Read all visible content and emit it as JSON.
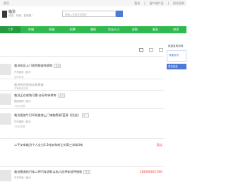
{
  "topbar": {
    "left_text": "首页",
    "links": [
      "登录",
      "|",
      "客户端产品",
      "|",
      "网站导航"
    ]
  },
  "header": {
    "city": "临汾",
    "city_tip": "欢迎，快速，高速度！",
    "search_placeholder": "请输入关键字或类型"
  },
  "nav": {
    "items": [
      "二手",
      "车辆",
      "房屋",
      "招聘",
      "兼职",
      "交友与人",
      "宠物",
      "服务",
      "商家"
    ]
  },
  "listings": [
    {
      "title": "临汾各区上门收购报废车辆车",
      "tag": "置顶",
      "meta": "汽车回收 | 临汾",
      "date": "实时时间"
    },
    {
      "title": "临汾附近的机动车报废",
      "tag": "",
      "meta": "",
      "date": "车辆报废收购"
    },
    {
      "title": "临汾正在收购可靠·办好的待转车",
      "tag": "置顶",
      "meta": "报废收购 | 临汾",
      "date": "1天前查看"
    },
    {
      "title": "临汾爱普牛打印机维修上门电脑黑屏/蓝屏【优选】",
      "tag": "热门",
      "meta": "打印维修 | 临汾",
      "date": "3天前查看"
    },
    {
      "title": "二手叉车临汾个人全力3.5吨叉车转让价高三米和3吨",
      "tag": "置顶",
      "meta": "",
      "date": "",
      "price": "面议"
    },
    {
      "title": "临汾靠谱的汽车二押汽车贷款以私人抵押车抵押借款",
      "tag": "置顶",
      "meta": "汽车贷款 | 临汾",
      "date": "",
      "phone": "18600002780"
    }
  ],
  "sidebar": {
    "title": "信息发布向导",
    "box_text": "我要发布",
    "button_text": "发布信息"
  }
}
